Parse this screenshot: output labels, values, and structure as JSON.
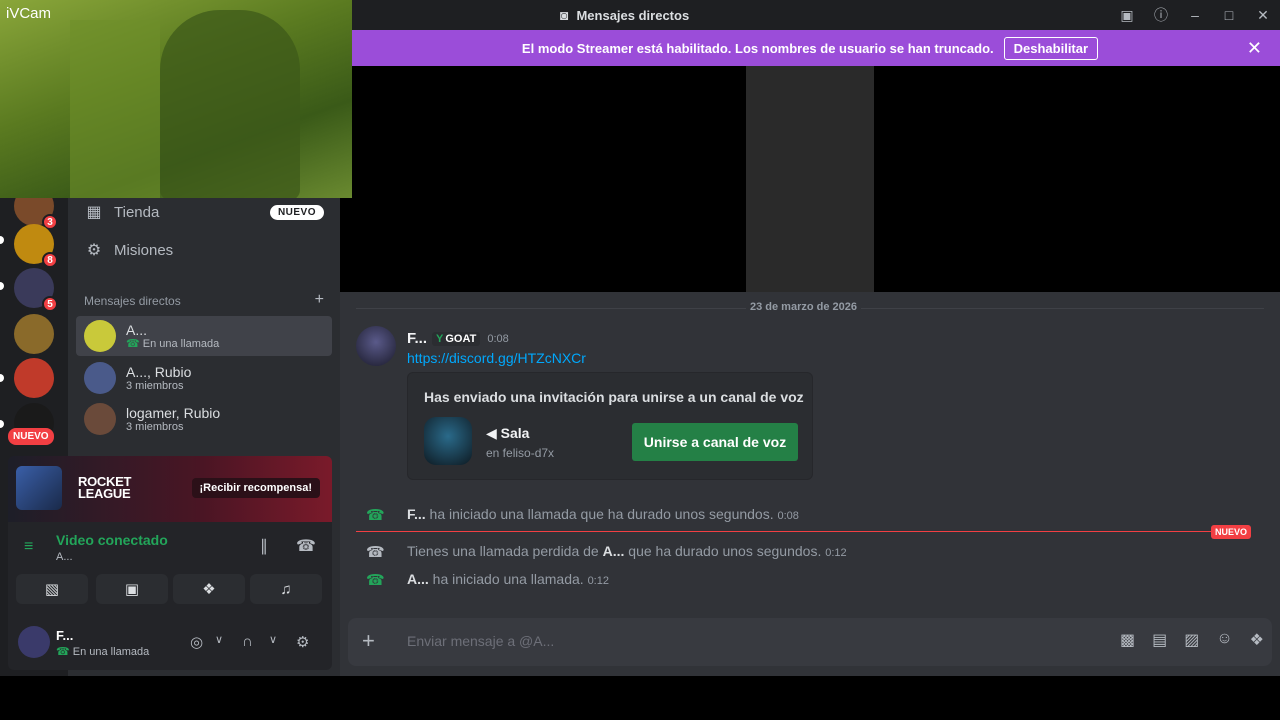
{
  "titlebar": {
    "title": "Mensajes directos"
  },
  "banner": {
    "text": "El modo Streamer está habilitado. Los nombres de usuario se han truncado.",
    "button": "Deshabilitar"
  },
  "webcam": {
    "label": "iVCam"
  },
  "servers": {
    "badges": [
      "3",
      "8",
      "5"
    ],
    "new_label": "NUEVO"
  },
  "nav": {
    "store": "Tienda",
    "store_badge": "NUEVO",
    "missions": "Misiones"
  },
  "dm_section": {
    "title": "Mensajes directos"
  },
  "dms": [
    {
      "name": "A...",
      "sub": "En una llamada"
    },
    {
      "name": "A..., Rubio",
      "sub": "3 miembros"
    },
    {
      "name": "logamer, Rubio",
      "sub": "3 miembros"
    }
  ],
  "promo": {
    "logo_line1": "ROCKET",
    "logo_line2": "LEAGUE",
    "button": "¡Recibir recompensa!"
  },
  "voice": {
    "status": "Video conectado",
    "channel": "A..."
  },
  "user": {
    "name": "F...",
    "status": "En una llamada"
  },
  "chat": {
    "date": "23 de marzo de 2026",
    "author": "F...",
    "tag": "GOAT",
    "time": "0:08",
    "link": "https://discord.gg/HTZcNXCr",
    "invite": {
      "title": "Has enviado una invitación para unirse a un canal de voz",
      "room": "Sala",
      "server": "en feliso-d7x",
      "button": "Unirse a canal de voz"
    },
    "system": [
      {
        "actor": "F...",
        "text_before": "",
        "text": " ha iniciado una llamada que ha durado unos segundos.",
        "time": "0:08"
      },
      {
        "actor": "A...",
        "text_before": "Tienes una llamada perdida de ",
        "text": " que ha durado unos segundos.",
        "time": "0:12"
      },
      {
        "actor": "A...",
        "text_before": "",
        "text": " ha iniciado una llamada.",
        "time": "0:12"
      }
    ],
    "new_marker": "NUEVO",
    "composer_placeholder": "Enviar mensaje a @A..."
  },
  "colors": {
    "accent": "#9b4dd9",
    "green": "#23a55a",
    "red": "#f23f43",
    "link": "#00a8fc"
  }
}
